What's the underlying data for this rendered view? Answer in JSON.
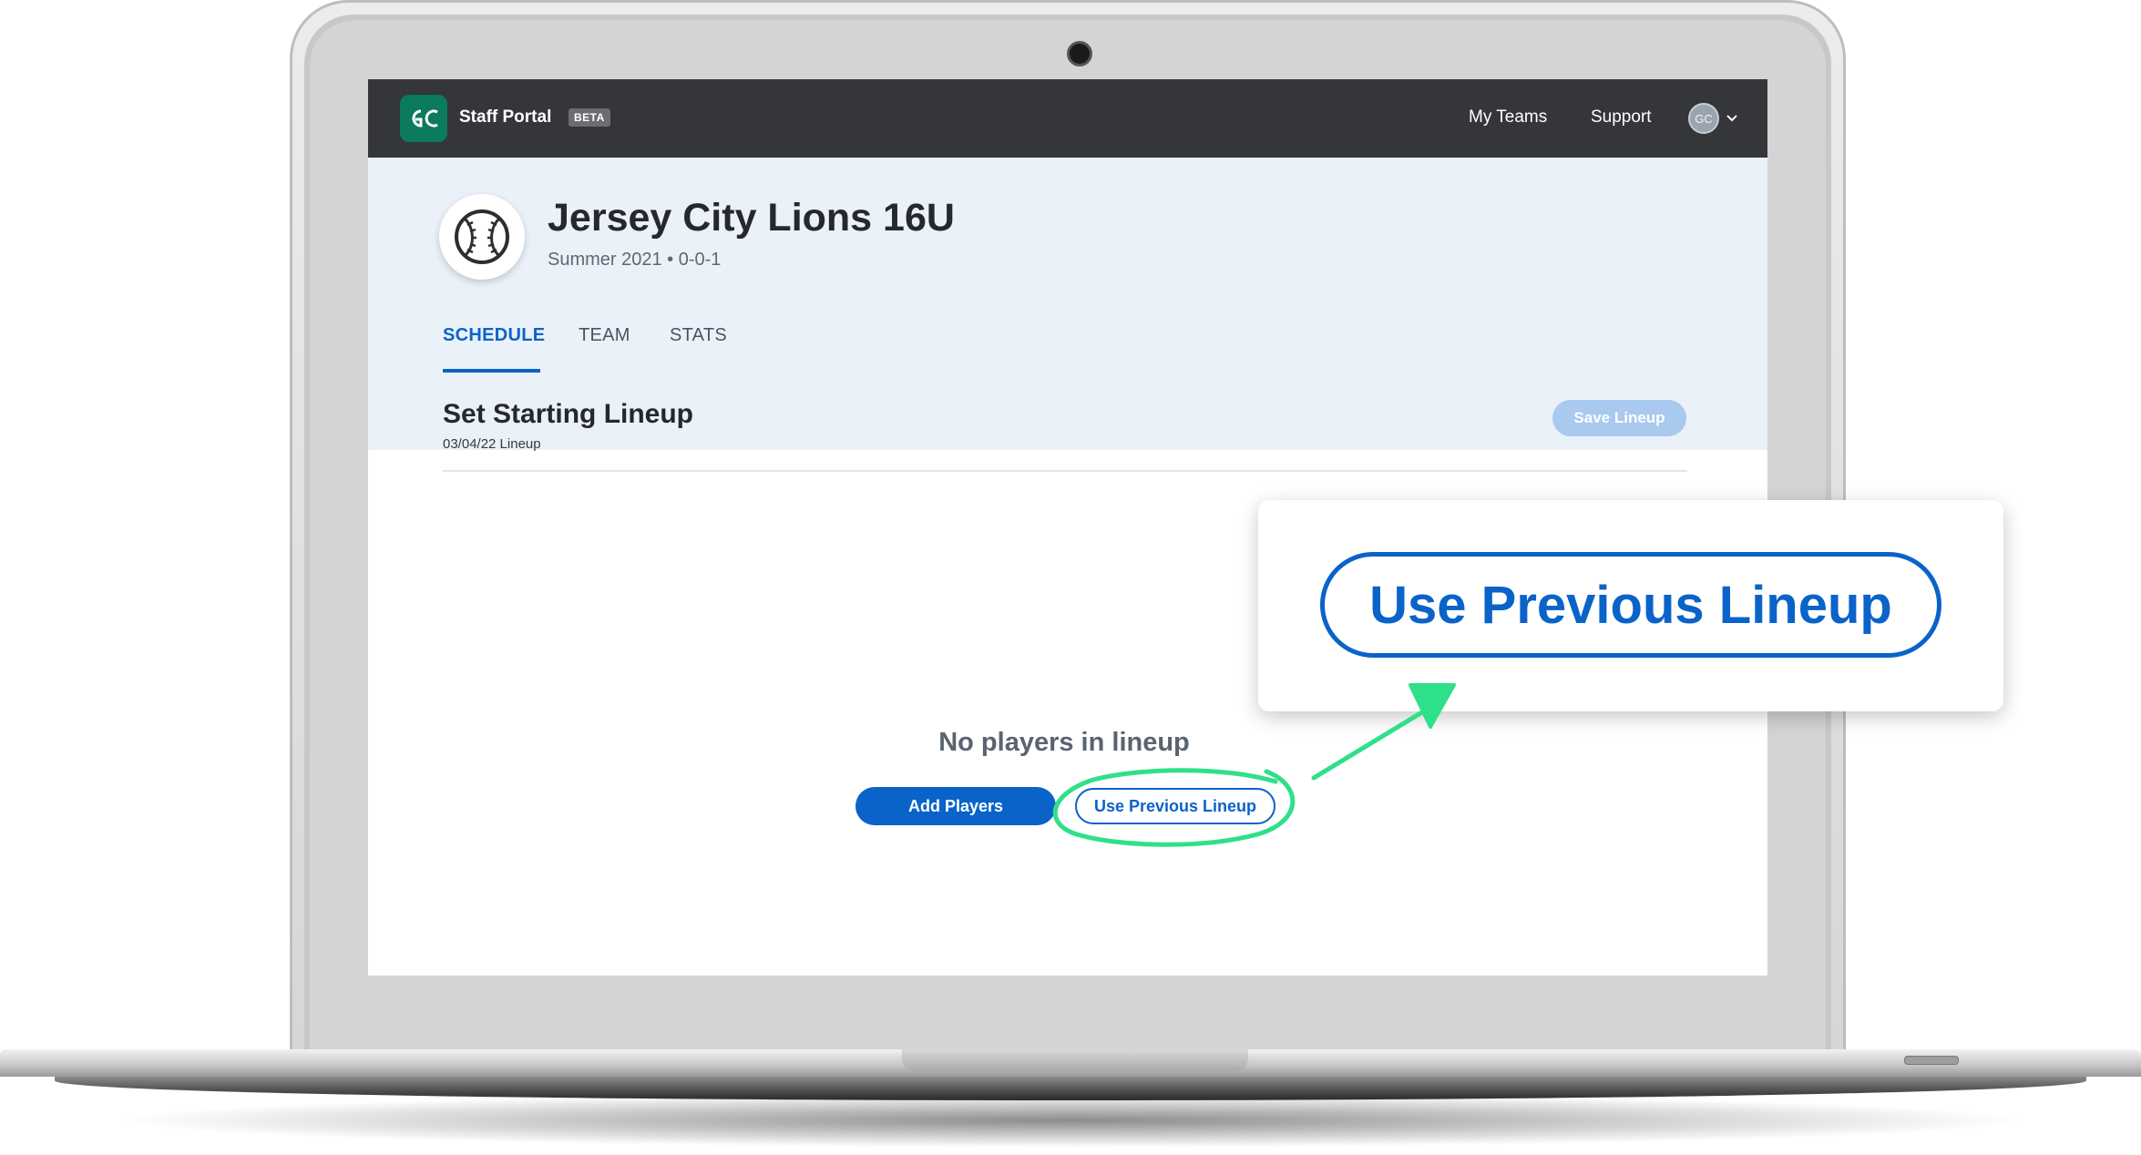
{
  "nav": {
    "brand": "Staff Portal",
    "badge": "BETA",
    "logo_text": "GC",
    "links": [
      "My Teams",
      "Support"
    ],
    "avatar_initials": "GC"
  },
  "team": {
    "name": "Jersey City Lions 16U",
    "subtitle": "Summer 2021 • 0-0-1"
  },
  "tabs": [
    {
      "label": "SCHEDULE",
      "active": true
    },
    {
      "label": "TEAM",
      "active": false
    },
    {
      "label": "STATS",
      "active": false
    }
  ],
  "lineup": {
    "title": "Set Starting Lineup",
    "subtitle": "03/04/22 Lineup",
    "save_label": "Save Lineup",
    "empty_title": "No players in lineup",
    "add_label": "Add Players",
    "previous_label": "Use Previous Lineup"
  },
  "callout": {
    "label": "Use Previous Lineup"
  },
  "colors": {
    "accent": "#0a63c9",
    "nav_bg": "#34363a",
    "header_bg": "#ebf1f9",
    "annotation": "#2fe08a",
    "logo_bg": "#0b7a5e"
  }
}
